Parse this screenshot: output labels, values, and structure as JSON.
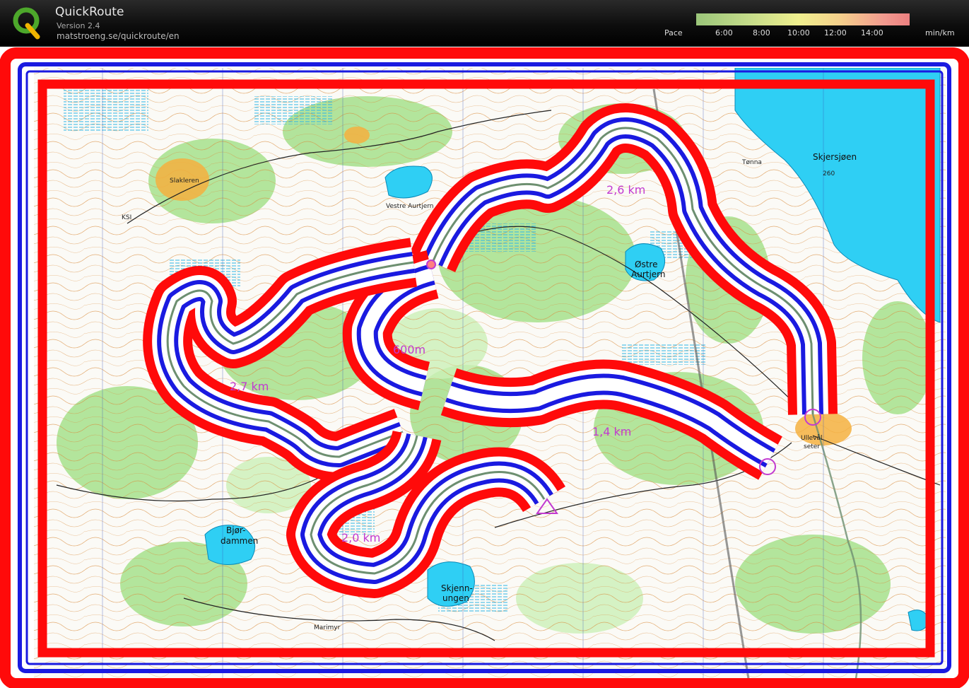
{
  "app": {
    "title": "QuickRoute",
    "version": "Version 2.4",
    "url": "matstroeng.se/quickroute/en"
  },
  "pace_scale": {
    "label": "Pace",
    "ticks": [
      "6:00",
      "8:00",
      "10:00",
      "12:00",
      "14:00"
    ],
    "unit": "min/km"
  },
  "legs": [
    {
      "label": "2,6 km"
    },
    {
      "label": "600m"
    },
    {
      "label": "2,7 km"
    },
    {
      "label": "1,4 km"
    },
    {
      "label": "2,0 km"
    }
  ],
  "map_labels": {
    "lake_skjersjoen": "Skjersjøen",
    "lake_height": "260",
    "tonna": "Tønna",
    "vestre_aurtjern": "Vestre Aurtjern",
    "ostre_aurtjern_1": "Østre",
    "ostre_aurtjern_2": "Aurtjern",
    "slakleren": "Slakleren",
    "ksi": "KSI",
    "bjor_1": "Bjør-",
    "bjor_2": "dammen",
    "skjenn_1": "Skjenn-",
    "skjenn_2": "ungen",
    "ulleval_1": "Ullevål",
    "ulleval_2": "seter",
    "marimyr": "Marimyr"
  },
  "colors": {
    "route_red": "#ff0a0a",
    "route_blue": "#1a1ae0",
    "course_purple": "#c23ad0",
    "water": "#2fcff4",
    "vegetation": "#a6e08c"
  }
}
